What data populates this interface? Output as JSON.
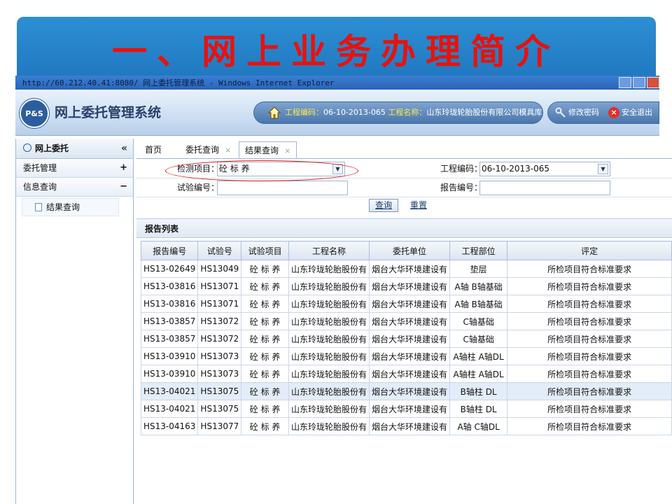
{
  "slide": {
    "title": "一、网上业务办理简介"
  },
  "browser": {
    "title_bar": "http://60.212.40.41:8080/    网上委托管理系统  - Windows Internet Explorer"
  },
  "header": {
    "logo_text": "P&S",
    "app_title": "网上委托管理系统",
    "project_code_label": "工程编码：",
    "project_code_value": "06-10-2013-065",
    "project_name_label": "工程名称：",
    "project_name_value": "山东玲珑轮胎股份有限公司模具库",
    "change_password": "修改密码",
    "logout": "安全退出",
    "colors": {
      "accent_yellow": "#ffe74a",
      "header_blue": "#4a76ad",
      "title_red": "#e8120c"
    }
  },
  "sidebar": {
    "title": "网上委托",
    "collapse_symbol": "«",
    "items": [
      {
        "label": "委托管理",
        "toggle": "+"
      },
      {
        "label": "信息查询",
        "toggle": "−"
      }
    ],
    "sub_items": [
      {
        "label": "结果查询"
      }
    ]
  },
  "tabs": [
    {
      "label": "首页",
      "closable": false
    },
    {
      "label": "委托查询",
      "closable": true
    },
    {
      "label": "结果查询",
      "closable": true
    }
  ],
  "tab_close_symbol": "×",
  "form": {
    "test_item_label": "检测项目：",
    "test_item_value": "砼 标 养",
    "project_code_label": "工程编码：",
    "project_code_value": "06-10-2013-065",
    "test_no_label": "试验编号：",
    "test_no_value": "",
    "report_no_label": "报告编号：",
    "report_no_value": "",
    "query_button": "查询",
    "reset_button": "重置"
  },
  "report_list": {
    "title": "报告列表",
    "columns": [
      "报告编号",
      "试验号",
      "试验项目",
      "工程名称",
      "委托单位",
      "工程部位",
      "评定"
    ],
    "rows": [
      [
        "HS13-02649",
        "HS13049",
        "砼 标 养",
        "山东玲珑轮胎股份有",
        "烟台大华环境建设有",
        "垫层",
        "所检项目符合标准要求"
      ],
      [
        "HS13-03816",
        "HS13071",
        "砼 标 养",
        "山东玲珑轮胎股份有",
        "烟台大华环境建设有",
        "A轴 B轴基础",
        "所检项目符合标准要求"
      ],
      [
        "HS13-03816",
        "HS13071",
        "砼 标 养",
        "山东玲珑轮胎股份有",
        "烟台大华环境建设有",
        "A轴 B轴基础",
        "所检项目符合标准要求"
      ],
      [
        "HS13-03857",
        "HS13072",
        "砼 标 养",
        "山东玲珑轮胎股份有",
        "烟台大华环境建设有",
        "C轴基础",
        "所检项目符合标准要求"
      ],
      [
        "HS13-03857",
        "HS13072",
        "砼 标 养",
        "山东玲珑轮胎股份有",
        "烟台大华环境建设有",
        "C轴基础",
        "所检项目符合标准要求"
      ],
      [
        "HS13-03910",
        "HS13073",
        "砼 标 养",
        "山东玲珑轮胎股份有",
        "烟台大华环境建设有",
        "A轴柱 A轴DL",
        "所检项目符合标准要求"
      ],
      [
        "HS13-03910",
        "HS13073",
        "砼 标 养",
        "山东玲珑轮胎股份有",
        "烟台大华环境建设有",
        "A轴柱 A轴DL",
        "所检项目符合标准要求"
      ],
      [
        "HS13-04021",
        "HS13075",
        "砼 标 养",
        "山东玲珑轮胎股份有",
        "烟台大华环境建设有",
        "B轴柱 DL",
        "所检项目符合标准要求"
      ],
      [
        "HS13-04021",
        "HS13075",
        "砼 标 养",
        "山东玲珑轮胎股份有",
        "烟台大华环境建设有",
        "B轴柱 DL",
        "所检项目符合标准要求"
      ],
      [
        "HS13-04163",
        "HS13077",
        "砼 标 养",
        "山东玲珑轮胎股份有",
        "烟台大华环境建设有",
        "A轴 C轴DL",
        "所检项目符合标准要求"
      ]
    ],
    "highlighted_row": 7
  }
}
